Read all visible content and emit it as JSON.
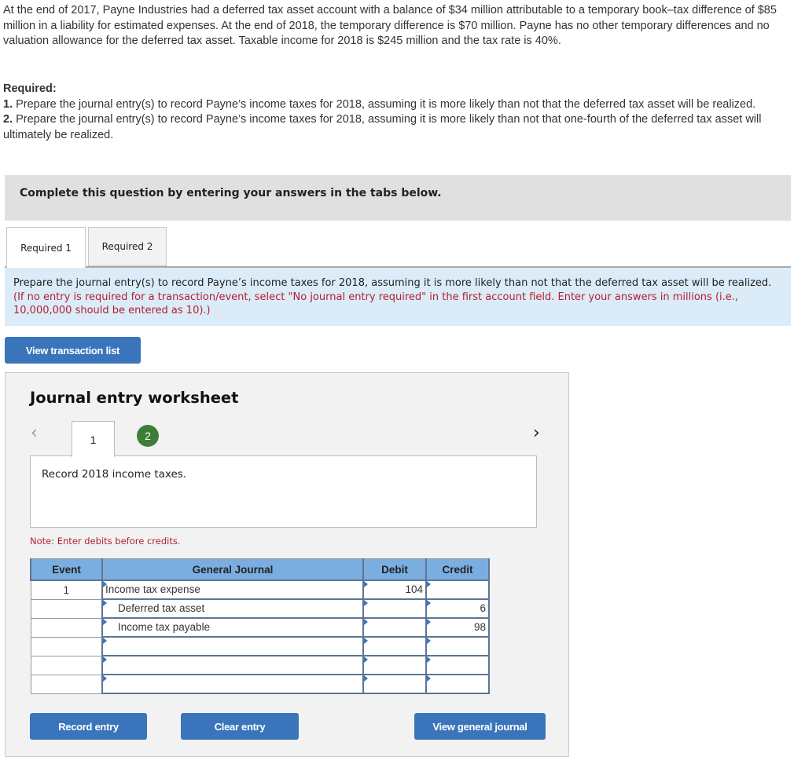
{
  "problem_text": "At the end of 2017, Payne Industries had a deferred tax asset account with a balance of $34 million attributable to a temporary book–tax difference of $85 million in a liability for estimated expenses. At the end of 2018, the temporary difference is $70 million. Payne has no other temporary differences and no valuation allowance for the deferred tax asset. Taxable income for 2018 is $245 million and the tax rate is 40%.",
  "required": {
    "heading": "Required:",
    "items": [
      {
        "num": "1.",
        "text": " Prepare the journal entry(s) to record Payne’s income taxes for 2018, assuming it is more likely than not that the deferred tax asset will be realized."
      },
      {
        "num": "2.",
        "text": " Prepare the journal entry(s) to record Payne’s income taxes for 2018, assuming it is more likely than not that one-fourth of the deferred tax asset will ultimately be realized."
      }
    ]
  },
  "complete_prompt": "Complete this question by entering your answers in the tabs below.",
  "tabs": [
    {
      "label": "Required 1",
      "active": true
    },
    {
      "label": "Required 2",
      "active": false
    }
  ],
  "instruction": {
    "main": "Prepare the journal entry(s) to record Payne’s income taxes for 2018, assuming it is more likely than not that the deferred tax asset will be realized. ",
    "note": "(If no entry is required for a transaction/event, select \"No journal entry required\" in the first account field. Enter your answers in millions (i.e., 10,000,000 should be entered as 10).)"
  },
  "view_transaction_list_label": "View transaction list",
  "worksheet": {
    "title": "Journal entry worksheet",
    "prev_icon": "‹",
    "next_icon": "›",
    "steps": [
      "1",
      "2"
    ],
    "description": "Record 2018 income taxes.",
    "note": "Note: Enter debits before credits.",
    "columns": [
      "Event",
      "General Journal",
      "Debit",
      "Credit"
    ],
    "rows": [
      {
        "event": "1",
        "account": "Income tax expense",
        "debit": "104",
        "credit": "",
        "indent": false
      },
      {
        "event": "",
        "account": "Deferred tax asset",
        "debit": "",
        "credit": "6",
        "indent": true
      },
      {
        "event": "",
        "account": "Income tax payable",
        "debit": "",
        "credit": "98",
        "indent": true
      },
      {
        "event": "",
        "account": "",
        "debit": "",
        "credit": "",
        "indent": false
      },
      {
        "event": "",
        "account": "",
        "debit": "",
        "credit": "",
        "indent": false
      },
      {
        "event": "",
        "account": "",
        "debit": "",
        "credit": "",
        "indent": false
      }
    ],
    "buttons": {
      "record": "Record entry",
      "clear": "Clear entry",
      "view_general_journal": "View general journal"
    }
  },
  "colors": {
    "button_blue": "#3a75bb",
    "header_blue": "#7aaee0",
    "instruction_bg": "#dcebf8",
    "note_red": "#b21f2d",
    "step_green": "#3d7d3a"
  }
}
